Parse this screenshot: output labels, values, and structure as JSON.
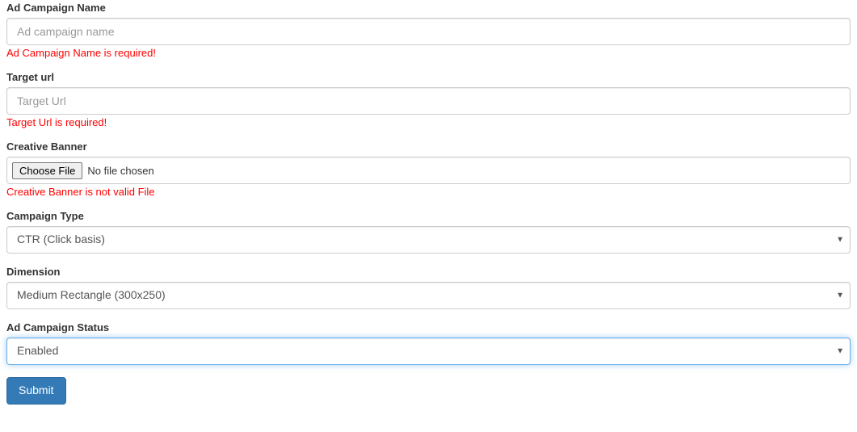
{
  "fields": {
    "name": {
      "label": "Ad Campaign Name",
      "placeholder": "Ad campaign name",
      "error": "Ad Campaign Name is required!"
    },
    "target_url": {
      "label": "Target url",
      "placeholder": "Target Url",
      "error": "Target Url is required!"
    },
    "banner": {
      "label": "Creative Banner",
      "button": "Choose File",
      "status": "No file chosen",
      "error": "Creative Banner is not valid File"
    },
    "type": {
      "label": "Campaign Type",
      "value": "CTR (Click basis)"
    },
    "dimension": {
      "label": "Dimension",
      "value": "Medium Rectangle (300x250)"
    },
    "status": {
      "label": "Ad Campaign Status",
      "value": "Enabled"
    }
  },
  "submit_label": "Submit"
}
